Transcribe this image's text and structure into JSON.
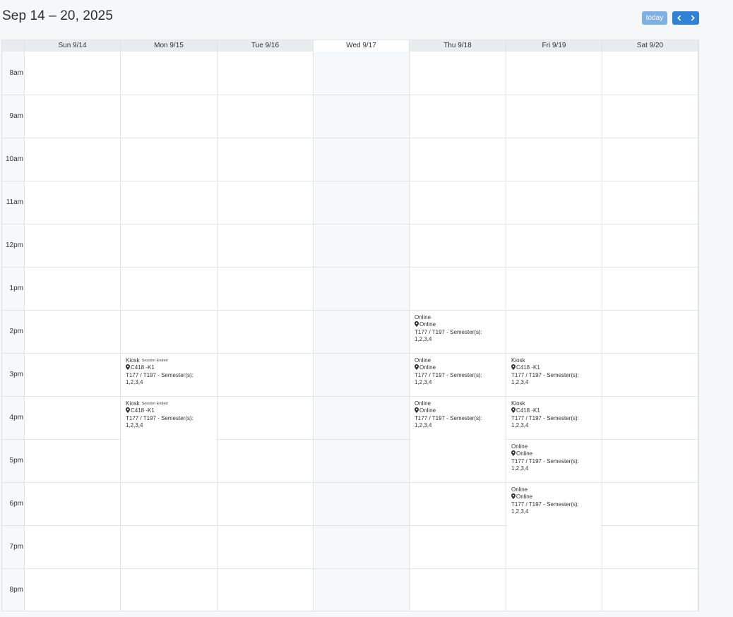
{
  "header": {
    "title": "Sep 14 – 20, 2025",
    "today_label": "today",
    "prev_icon": "chevron-left-icon",
    "next_icon": "chevron-right-icon"
  },
  "days": [
    {
      "label": "Sun 9/14"
    },
    {
      "label": "Mon 9/15"
    },
    {
      "label": "Tue 9/16"
    },
    {
      "label": "Wed 9/17"
    },
    {
      "label": "Thu 9/18"
    },
    {
      "label": "Fri 9/19"
    },
    {
      "label": "Sat 9/20"
    }
  ],
  "hours": [
    "8am",
    "9am",
    "10am",
    "11am",
    "12pm",
    "1pm",
    "2pm",
    "3pm",
    "4pm",
    "5pm",
    "6pm",
    "7pm",
    "8pm"
  ],
  "events": [
    {
      "day": 1,
      "start": "3pm",
      "end": "4pm",
      "title": "Kiosk",
      "badge": "Session Ended",
      "location": "C418 -K1",
      "desc": "T177 / T197 - Semester(s): 1,2,3,4"
    },
    {
      "day": 1,
      "start": "4pm",
      "end": "6pm",
      "title": "Kiosk",
      "badge": "Session Ended",
      "location": "C418 -K1",
      "desc": "T177 / T197 - Semester(s): 1,2,3,4"
    },
    {
      "day": 4,
      "start": "2pm",
      "end": "3pm",
      "title": "Online",
      "badge": "",
      "location": "Online",
      "desc": "T177 / T197 - Semester(s): 1,2,3,4"
    },
    {
      "day": 4,
      "start": "3pm",
      "end": "4pm",
      "title": "Online",
      "badge": "",
      "location": "Online",
      "desc": "T177 / T197 - Semester(s): 1,2,3,4"
    },
    {
      "day": 4,
      "start": "4pm",
      "end": "6pm",
      "title": "Online",
      "badge": "",
      "location": "Online",
      "desc": "T177 / T197 - Semester(s): 1,2,3,4"
    },
    {
      "day": 5,
      "start": "3pm",
      "end": "4pm",
      "title": "Kiosk",
      "badge": "",
      "location": "C418 -K1",
      "desc": "T177 / T197 - Semester(s): 1,2,3,4"
    },
    {
      "day": 5,
      "start": "4pm",
      "end": "5pm",
      "title": "Kiosk",
      "badge": "",
      "location": "C418 -K1",
      "desc": "T177 / T197 - Semester(s): 1,2,3,4"
    },
    {
      "day": 5,
      "start": "5pm",
      "end": "6pm",
      "title": "Online",
      "badge": "",
      "location": "Online",
      "desc": "T177 / T197 - Semester(s): 1,2,3,4"
    },
    {
      "day": 5,
      "start": "6pm",
      "end": "8pm",
      "title": "Online",
      "badge": "",
      "location": "Online",
      "desc": "T177 / T197 - Semester(s): 1,2,3,4"
    }
  ],
  "current_day_index": 3,
  "colors": {
    "accent": "#2f82d6",
    "today_button": "#7fb0e4"
  }
}
